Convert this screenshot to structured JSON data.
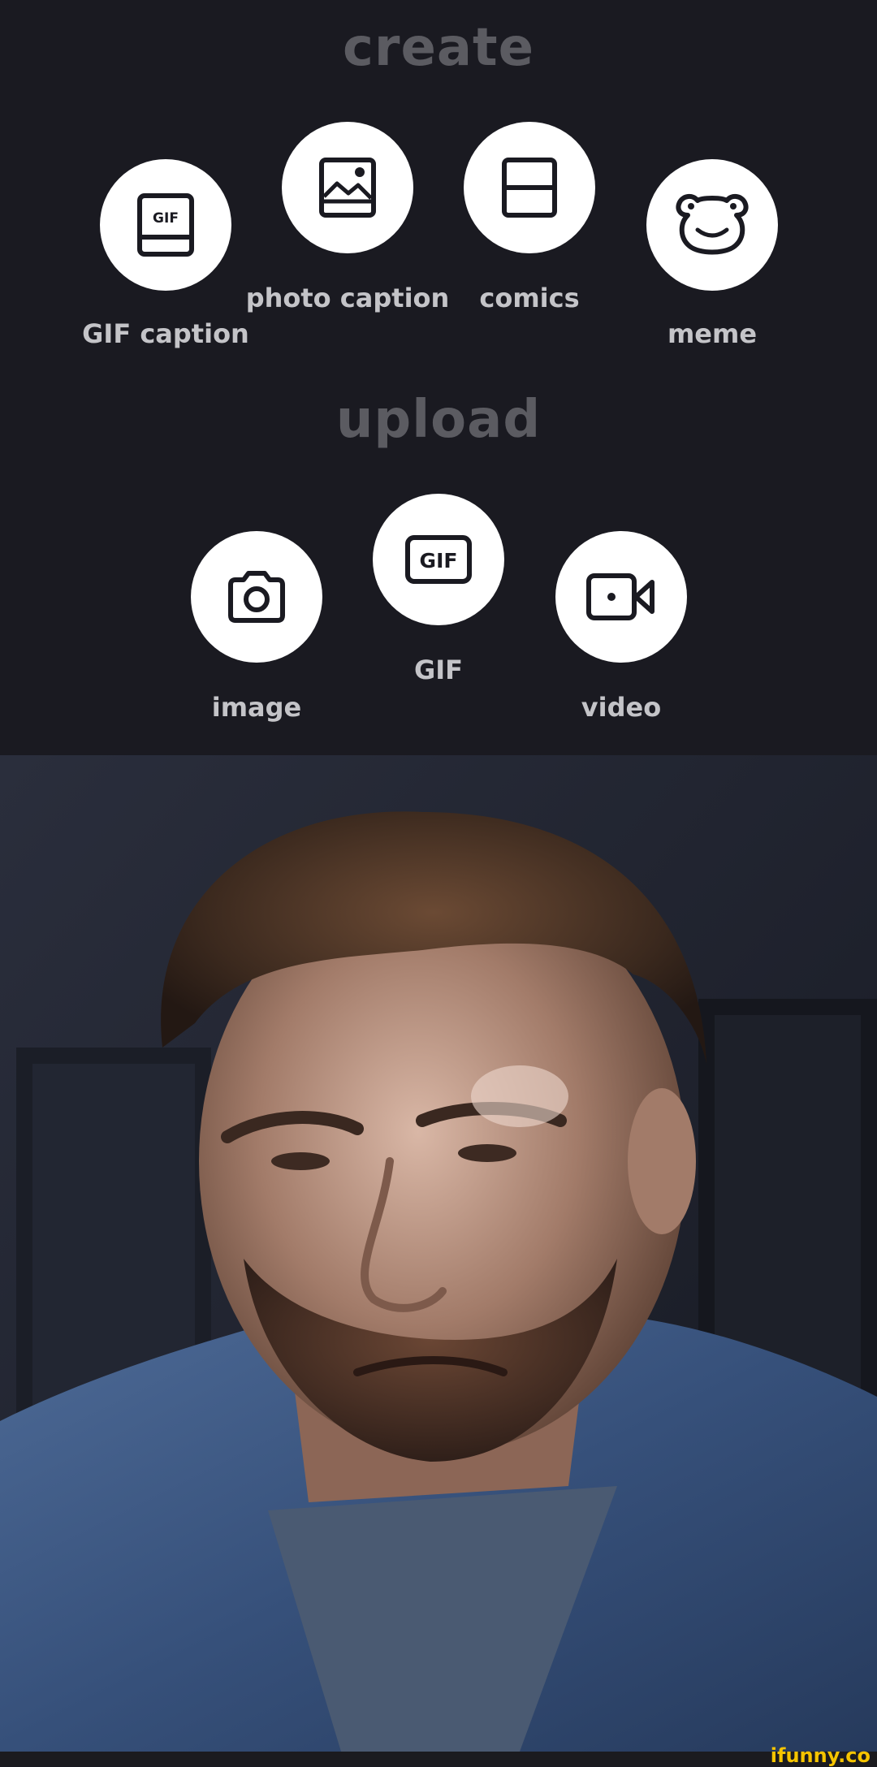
{
  "create": {
    "title": "create",
    "items": [
      {
        "label": "GIF caption",
        "icon": "gif-caption-icon"
      },
      {
        "label": "photo caption",
        "icon": "photo-icon"
      },
      {
        "label": "comics",
        "icon": "comics-panel-icon"
      },
      {
        "label": "meme",
        "icon": "frog-face-icon"
      }
    ]
  },
  "upload": {
    "title": "upload",
    "items": [
      {
        "label": "image",
        "icon": "camera-icon"
      },
      {
        "label": "GIF",
        "icon": "gif-icon"
      },
      {
        "label": "video",
        "icon": "video-camera-icon"
      }
    ]
  },
  "watermark": "ifunny.co",
  "colors": {
    "background": "#1a1a21",
    "section_title": "#5b5b61",
    "label": "#c4c4c8",
    "button": "#ffffff",
    "icon": "#1a1a21",
    "watermark": "#f5c400"
  }
}
